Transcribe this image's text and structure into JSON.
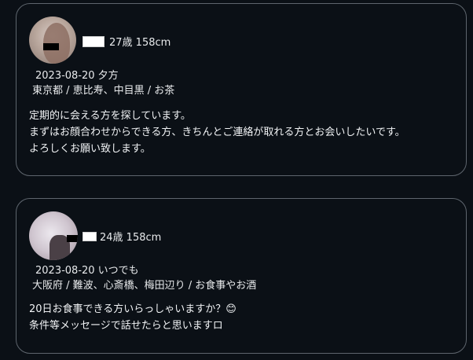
{
  "posts": [
    {
      "age_height": "27歳  158cm",
      "date_time": "2023-08-20  夕方",
      "location": "東京都 / 恵比寿、中目黒 / お茶",
      "message_lines": [
        "定期的に会える方を探しています。",
        "まずはお顔合わせからできる方、きちんとご連絡が取れる方とお会いしたいです。",
        "よろしくお願い致します。"
      ]
    },
    {
      "age_height": "24歳  158cm",
      "date_time": "2023-08-20  いつでも",
      "location": "大阪府 / 難波、心斎橋、梅田辺り / お食事やお酒",
      "message_lines": [
        "20日お食事できる方いらっしゃいますか？😊",
        "条件等メッセージで話せたらと思いますロ"
      ]
    }
  ],
  "colors": {
    "background": "#0b1016",
    "card_border": "#5e656d",
    "text": "#f1f3f5"
  }
}
